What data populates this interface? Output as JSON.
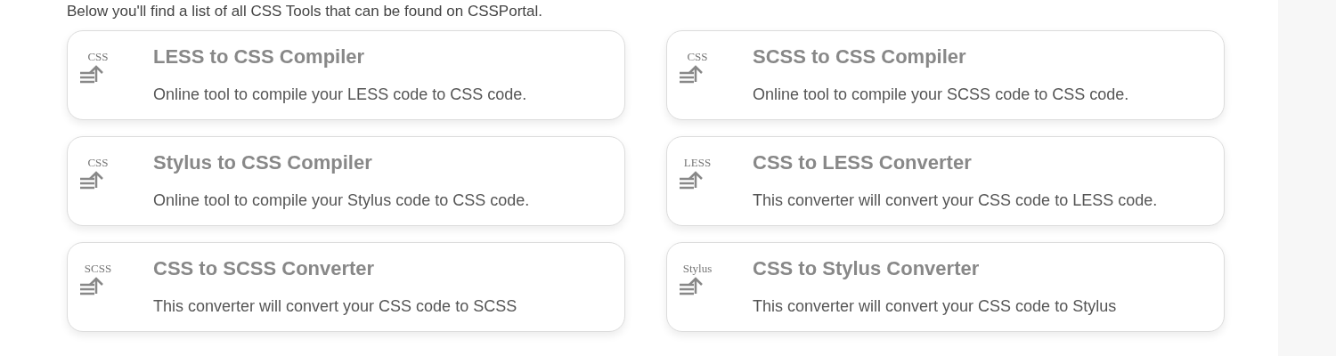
{
  "intro": "Below you'll find a list of all CSS Tools that can be found on CSSPortal.",
  "tools": [
    {
      "badge": "CSS",
      "title": "LESS to CSS Compiler",
      "description": "Online tool to compile your LESS code to CSS code."
    },
    {
      "badge": "CSS",
      "title": "SCSS to CSS Compiler",
      "description": "Online tool to compile your SCSS code to CSS code."
    },
    {
      "badge": "CSS",
      "title": "Stylus to CSS Compiler",
      "description": "Online tool to compile your Stylus code to CSS code."
    },
    {
      "badge": "LESS",
      "title": "CSS to LESS Converter",
      "description": "This converter will convert your CSS code to LESS code."
    },
    {
      "badge": "SCSS",
      "title": "CSS to SCSS Converter",
      "description": "This converter will convert your CSS code to SCSS"
    },
    {
      "badge": "Stylus",
      "title": "CSS to Stylus Converter",
      "description": "This converter will convert your CSS code to Stylus"
    }
  ]
}
